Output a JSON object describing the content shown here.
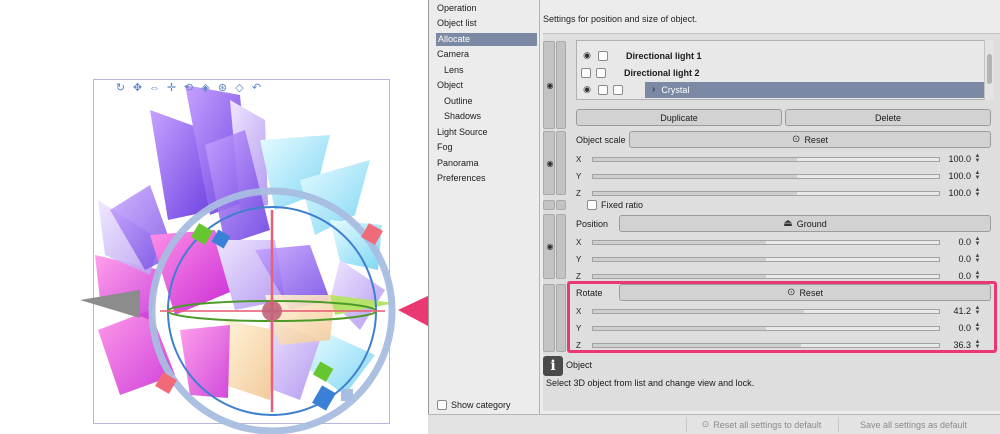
{
  "toolbar3d": {
    "tools": [
      "camera-rotate-icon",
      "camera-pan-icon",
      "camera-dolly-icon",
      "move-icon",
      "rotate-object-icon",
      "rotate-xy-icon",
      "rotate-z-icon",
      "scale-icon",
      "undo-icon"
    ],
    "glyphs": [
      "↻",
      "✥",
      "⇔",
      "✛",
      "⟲",
      "◈",
      "⊛",
      "◇",
      "↶"
    ]
  },
  "categories": [
    {
      "label": "Operation",
      "sub": false,
      "selected": false
    },
    {
      "label": "Object list",
      "sub": false,
      "selected": false
    },
    {
      "label": "Allocate",
      "sub": false,
      "selected": true
    },
    {
      "label": "Camera",
      "sub": false,
      "selected": false
    },
    {
      "label": "Lens",
      "sub": true,
      "selected": false
    },
    {
      "label": "Object",
      "sub": false,
      "selected": false
    },
    {
      "label": "Outline",
      "sub": true,
      "selected": false
    },
    {
      "label": "Shadows",
      "sub": true,
      "selected": false
    },
    {
      "label": "Light Source",
      "sub": false,
      "selected": false
    },
    {
      "label": "Fog",
      "sub": false,
      "selected": false
    },
    {
      "label": "Panorama",
      "sub": false,
      "selected": false
    },
    {
      "label": "Preferences",
      "sub": false,
      "selected": false
    }
  ],
  "show_category": {
    "label": "Show category",
    "checked": false
  },
  "description": "Settings for position and size of object.",
  "object_list": {
    "rows": [
      {
        "name": "Directional light 1",
        "visible": true,
        "selected": false,
        "expandable": false
      },
      {
        "name": "Directional light 2",
        "visible": false,
        "selected": false,
        "expandable": false
      },
      {
        "name": "Crystal",
        "visible": true,
        "selected": true,
        "expandable": true
      }
    ]
  },
  "buttons": {
    "duplicate": "Duplicate",
    "delete": "Delete",
    "reset_scale": "Reset",
    "ground": "Ground",
    "reset_rotate": "Reset"
  },
  "object_scale": {
    "label": "Object scale",
    "fixed_ratio": "Fixed ratio",
    "axes": [
      {
        "axis": "X",
        "value": "100.0",
        "fill": 0.59
      },
      {
        "axis": "Y",
        "value": "100.0",
        "fill": 0.59
      },
      {
        "axis": "Z",
        "value": "100.0",
        "fill": 0.59
      }
    ]
  },
  "position": {
    "label": "Position",
    "axes": [
      {
        "axis": "X",
        "value": "0.0",
        "fill": 0.5
      },
      {
        "axis": "Y",
        "value": "0.0",
        "fill": 0.5
      },
      {
        "axis": "Z",
        "value": "0.0",
        "fill": 0.5
      }
    ]
  },
  "rotate": {
    "label": "Rotate",
    "axes": [
      {
        "axis": "X",
        "value": "41.2",
        "fill": 0.61
      },
      {
        "axis": "Y",
        "value": "0.0",
        "fill": 0.5
      },
      {
        "axis": "Z",
        "value": "36.3",
        "fill": 0.6
      }
    ]
  },
  "info": {
    "title": "Object",
    "text": "Select 3D object from list and change view and lock."
  },
  "footer": {
    "reset_all": "Reset all settings to default",
    "save_all": "Save all settings as default"
  },
  "colors": {
    "selection": "#7c89a5",
    "highlight": "#ea3873",
    "gizmo_ring": "#9cb6dd",
    "gizmo_handle_green": "#66c630",
    "gizmo_handle_blue": "#3a80d6",
    "gizmo_handle_red": "#f06a7a"
  }
}
